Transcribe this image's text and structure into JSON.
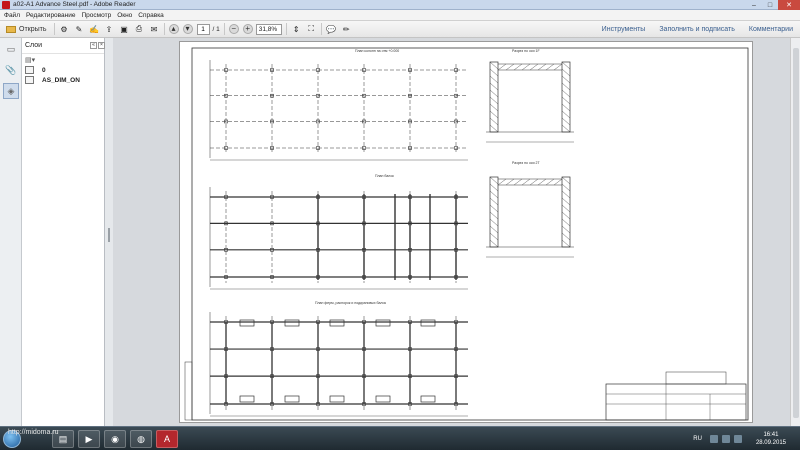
{
  "window": {
    "title": "a02-A1 Advance Steel.pdf - Adobe Reader",
    "controls": [
      "–",
      "□",
      "✕"
    ]
  },
  "menu": [
    "Файл",
    "Редактирование",
    "Просмотр",
    "Окно",
    "Справка"
  ],
  "toolbar": {
    "open_label": "Открыть",
    "current_page": "1",
    "total_pages": "/ 1",
    "zoom": "31,8%",
    "zoom_out": "−",
    "zoom_in": "+",
    "links": [
      "Инструменты",
      "Заполнить и подписать",
      "Комментарии"
    ]
  },
  "layers_panel": {
    "title": "Слои",
    "items": [
      {
        "name": "0"
      },
      {
        "name": "AS_DIM_ON"
      }
    ]
  },
  "drawing": {
    "plan1_title": "План колонн на отм +0.000",
    "plan2_title": "План балок",
    "plan3_title": "План ферм, распорок и подкрановых балок",
    "section1_title": "Разрез по оси 1F",
    "section2_title": "Разрез по оси 2T"
  },
  "taskbar": {
    "watermark": "http://midoma.ru",
    "language": "RU",
    "time": "16:41",
    "date": "28.09.2015"
  },
  "colors": {
    "titlebar": "#c9d8ec",
    "link": "#3a5f8f",
    "taskbar": "#2b3840",
    "close": "#c94a3f"
  }
}
